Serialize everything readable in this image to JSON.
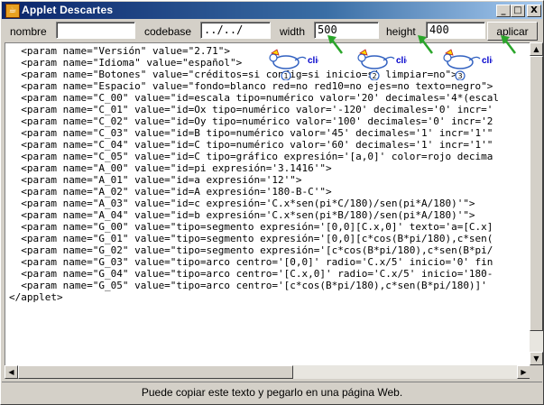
{
  "window": {
    "title": "Applet Descartes",
    "icon_name": "java-applet-icon",
    "controls": {
      "minimize": "_",
      "maximize": "□",
      "close": "X"
    }
  },
  "toolbar": {
    "nombre_label": "nombre",
    "nombre_value": "",
    "codebase_label": "codebase",
    "codebase_value": "../../",
    "width_label": "width",
    "width_value": "500",
    "height_label": "height",
    "height_value": "400",
    "apply_label": "aplicar"
  },
  "hints": [
    {
      "number": "1",
      "text": "clic"
    },
    {
      "number": "2",
      "text": "clic"
    },
    {
      "number": "3",
      "text": "clic"
    }
  ],
  "code_lines": [
    "  <param name=\"Versión\" value=\"2.71\">",
    "  <param name=\"Idioma\" value=\"español\">",
    "  <param name=\"Botones\" value=\"créditos=si config=si inicio=si limpiar=no\">",
    "  <param name=\"Espacio\" value=\"fondo=blanco red=no red10=no ejes=no texto=negro\">",
    "  <param name=\"C_00\" value=\"id=escala tipo=numérico valor='20' decimales='4*(escal",
    "  <param name=\"C_01\" value=\"id=Ox tipo=numérico valor='-120' decimales='0' incr='",
    "  <param name=\"C_02\" value=\"id=Oy tipo=numérico valor='100' decimales='0' incr='2",
    "  <param name=\"C_03\" value=\"id=B tipo=numérico valor='45' decimales='1' incr='1'\"",
    "  <param name=\"C_04\" value=\"id=C tipo=numérico valor='60' decimales='1' incr='1'\"",
    "  <param name=\"C_05\" value=\"id=C tipo=gráfico expresión='[a,0]' color=rojo decima",
    "  <param name=\"A_00\" value=\"id=pi expresión='3.1416'\">",
    "  <param name=\"A_01\" value=\"id=a expresión='12'\">",
    "  <param name=\"A_02\" value=\"id=A expresión='180-B-C'\">",
    "  <param name=\"A_03\" value=\"id=c expresión='C.x*sen(pi*C/180)/sen(pi*A/180)'\">",
    "  <param name=\"A_04\" value=\"id=b expresión='C.x*sen(pi*B/180)/sen(pi*A/180)'\">",
    "  <param name=\"G_00\" value=\"tipo=segmento expresión='[0,0][C.x,0]' texto='a=[C.x]",
    "  <param name=\"G_01\" value=\"tipo=segmento expresión='[0,0][c*cos(B*pi/180),c*sen(",
    "  <param name=\"G_02\" value=\"tipo=segmento expresión='[c*cos(B*pi/180),c*sen(B*pi/",
    "  <param name=\"G_03\" value=\"tipo=arco centro='[0,0]' radio='C.x/5' inicio='0' fin",
    "  <param name=\"G_04\" value=\"tipo=arco centro='[C.x,0]' radio='C.x/5' inicio='180-",
    "  <param name=\"G_05\" value=\"tipo=arco centro='[c*cos(B*pi/180),c*sen(B*pi/180)]'",
    "</applet>"
  ],
  "scrollbar": {
    "up": "▲",
    "down": "▼",
    "left": "◀",
    "right": "▶"
  },
  "status_text": "Puede copiar este texto y pegarlo en una página Web.",
  "colors": {
    "title_start": "#0a246a",
    "title_end": "#a6caf0",
    "hint_arrow": "#2aa52a",
    "clic_text": "#0000cc"
  }
}
